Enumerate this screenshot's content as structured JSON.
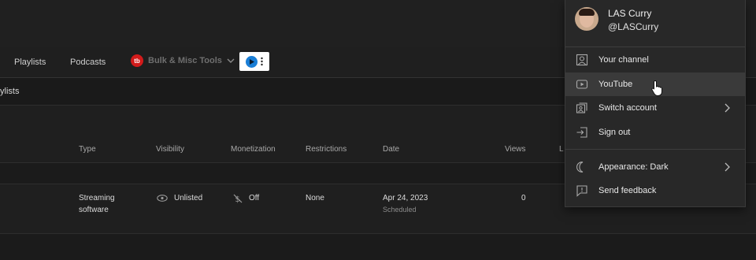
{
  "tabs": [
    "Playlists",
    "Podcasts"
  ],
  "toolbar": {
    "bulk_label": "Bulk & Misc Tools",
    "logo_text": "tb"
  },
  "filter": {
    "label": "ylists"
  },
  "table": {
    "headers": [
      "Type",
      "Visibility",
      "Monetization",
      "Restrictions",
      "Date",
      "Views",
      "L"
    ],
    "row": {
      "type_line1": "Streaming",
      "type_line2": "software",
      "visibility": "Unlisted",
      "monetization": "Off",
      "restrictions": "None",
      "date": "Apr 24, 2023",
      "date_status": "Scheduled",
      "views": "0"
    }
  },
  "account_menu": {
    "name": "LAS Curry",
    "handle": "@LASCurry",
    "items": [
      {
        "label": "Your channel",
        "icon": "person-box-icon"
      },
      {
        "label": "YouTube",
        "icon": "play-box-icon"
      },
      {
        "label": "Switch account",
        "icon": "switch-account-icon"
      },
      {
        "label": "Sign out",
        "icon": "sign-out-icon"
      },
      {
        "label": "Appearance: Dark",
        "icon": "moon-icon"
      },
      {
        "label": "Send feedback",
        "icon": "feedback-icon"
      }
    ]
  },
  "colors": {
    "accent_red": "#d21b1b",
    "menu_bg": "#282828",
    "highlight": "#3a3a3a",
    "ext_blue": "#1a7ed6"
  }
}
